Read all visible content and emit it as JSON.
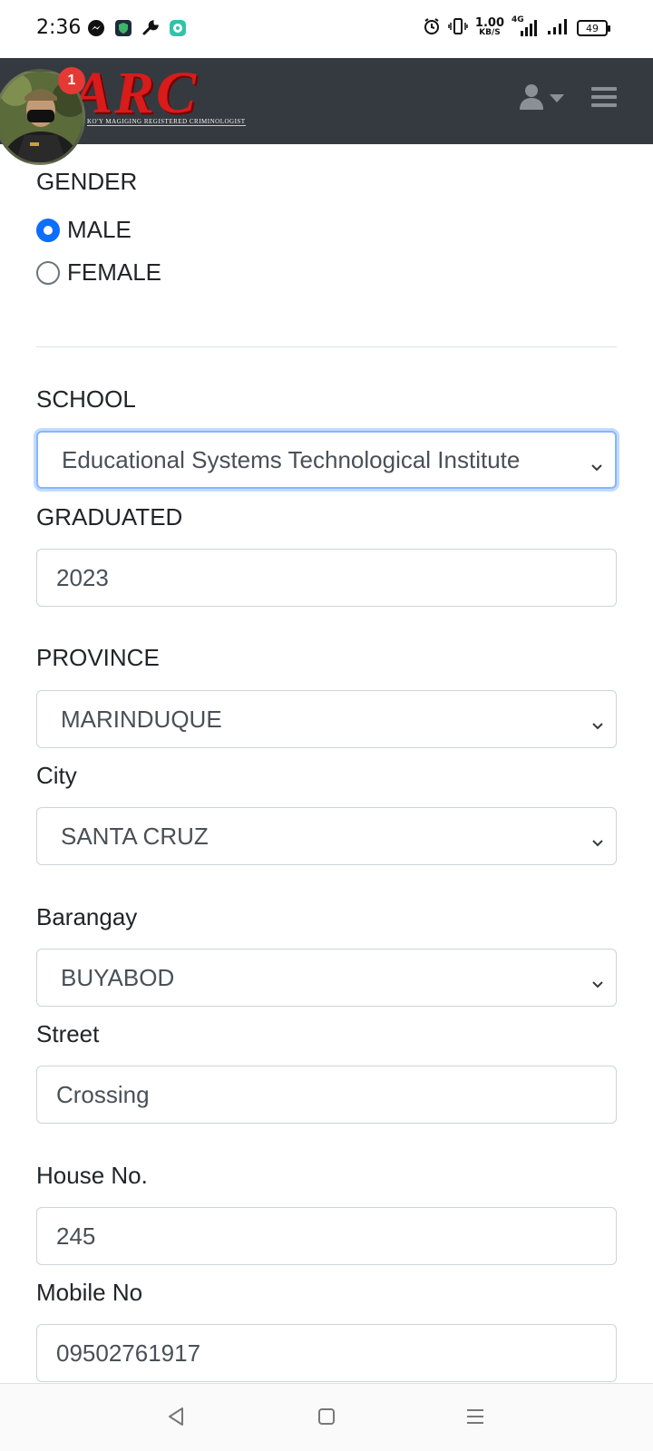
{
  "status_bar": {
    "time": "2:36",
    "net_speed_value": "1.00",
    "net_speed_unit": "KB/S",
    "battery": "49",
    "network_label": "4G"
  },
  "navbar": {
    "brand_title": "ARC",
    "brand_subtitle": "KO'Y MAGIGING REGISTERED CRIMINOLOGIST",
    "notification_count": "1"
  },
  "form": {
    "gender": {
      "label": "GENDER",
      "options": [
        {
          "label": "MALE",
          "checked": true
        },
        {
          "label": "FEMALE",
          "checked": false
        }
      ]
    },
    "school": {
      "label": "SCHOOL",
      "value": "Educational Systems Technological Institute"
    },
    "graduated": {
      "label": "GRADUATED",
      "value": "2023"
    },
    "province": {
      "label": "PROVINCE",
      "value": "MARINDUQUE"
    },
    "city": {
      "label": "City",
      "value": "SANTA CRUZ"
    },
    "barangay": {
      "label": "Barangay",
      "value": "BUYABOD"
    },
    "street": {
      "label": "Street",
      "value": "Crossing"
    },
    "house_no": {
      "label": "House No.",
      "value": "245"
    },
    "mobile_no": {
      "label": "Mobile No",
      "value": "09502761917"
    }
  },
  "colors": {
    "navbar_bg": "#343a40",
    "accent": "#0d6efd",
    "brand_red": "#d81b1b",
    "badge_red": "#e53935"
  }
}
